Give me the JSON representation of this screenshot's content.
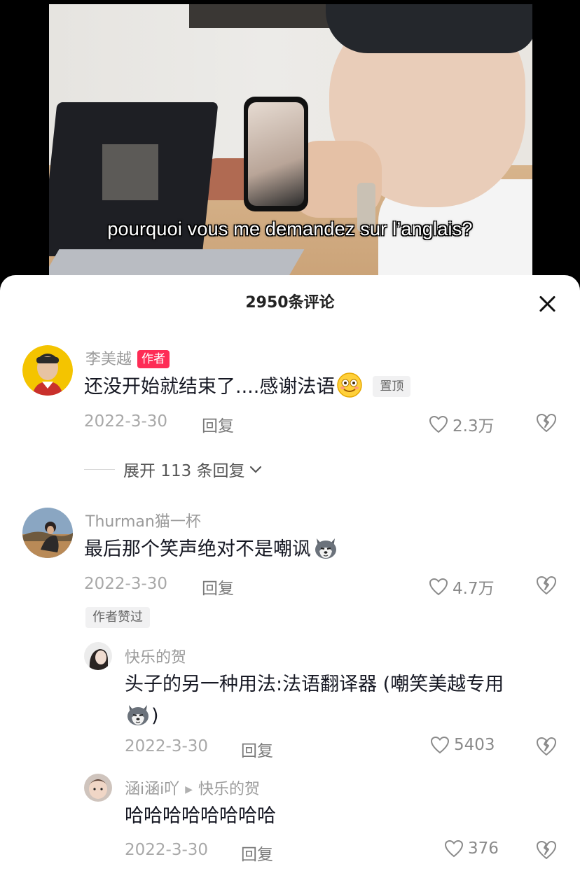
{
  "video": {
    "subtitle": "pourquoi vous me demandez sur l’anglais?"
  },
  "sheet": {
    "title": "2950条评论",
    "close_icon": "close-icon"
  },
  "expand_replies": {
    "label": "展开 113 条回复"
  },
  "comments": [
    {
      "name": "李美越",
      "author_tag": "作者",
      "text": "还没开始就结束了....感谢法语",
      "emoji": "smiling-face-icon",
      "pin_tag": "置顶",
      "date": "2022-3-30",
      "reply_label": "回复",
      "likes": "2.3万"
    },
    {
      "name": "Thurman猫一杯",
      "text": "最后那个笑声绝对不是嘲讽",
      "emoji": "husky-dog-icon",
      "date": "2022-3-30",
      "reply_label": "回复",
      "likes": "4.7万",
      "liked_by_author": "作者赞过"
    }
  ],
  "replies": [
    {
      "name": "快乐的贺",
      "text_line1": "头子的另一种用法:法语翻译器 (嘲笑美越专用",
      "text_line2": ")",
      "emoji": "husky-dog-icon",
      "date": "2022-3-30",
      "reply_label": "回复",
      "likes": "5403"
    },
    {
      "name": "涵i涵i吖",
      "reply_to": "快乐的贺",
      "text": "哈哈哈哈哈哈哈哈",
      "date": "2022-3-30",
      "reply_label": "回复",
      "likes": "376"
    }
  ],
  "colors": {
    "author_tag": "#fe2c55",
    "name": "#9a9a9a",
    "text": "#161823"
  }
}
